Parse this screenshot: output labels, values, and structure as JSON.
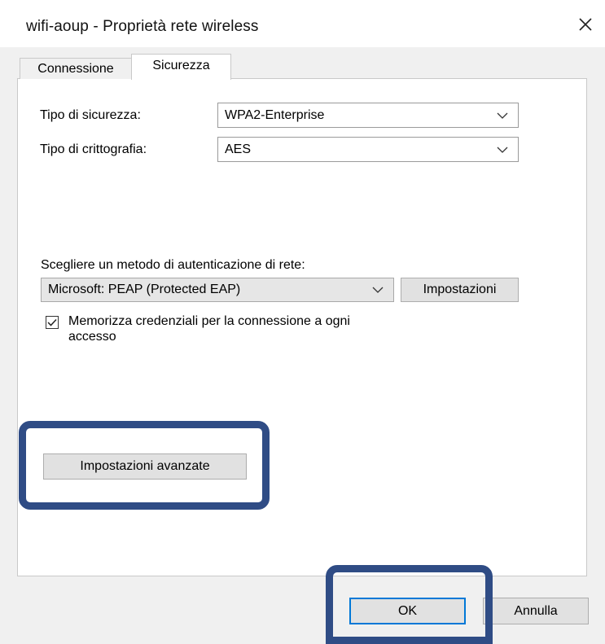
{
  "window": {
    "title": "wifi-aoup - Proprietà rete wireless",
    "close_icon": "close-icon"
  },
  "tabs": [
    {
      "label": "Connessione",
      "active": false
    },
    {
      "label": "Sicurezza",
      "active": true
    }
  ],
  "security": {
    "type_label": "Tipo di sicurezza:",
    "type_value": "WPA2-Enterprise",
    "encryption_label": "Tipo di crittografia:",
    "encryption_value": "AES"
  },
  "auth": {
    "method_label": "Scegliere un metodo di autenticazione di rete:",
    "method_value": "Microsoft: PEAP (Protected EAP)",
    "settings_button": "Impostazioni",
    "remember_checked": true,
    "remember_label_line1": "Memorizza credenziali per la connessione a ogni",
    "remember_label_line2": "accesso"
  },
  "advanced_button": "Impostazioni avanzate",
  "footer": {
    "ok_button": "OK",
    "cancel_button": "Annulla"
  },
  "colors": {
    "highlight": "#2f4c85",
    "default_button_border": "#0078d7"
  }
}
